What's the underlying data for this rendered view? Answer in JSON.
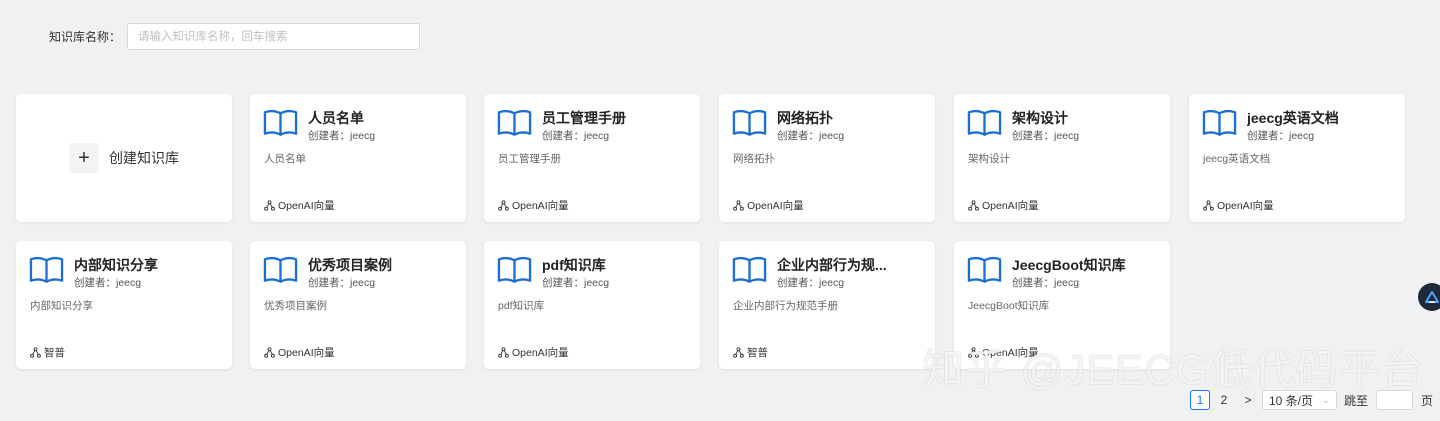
{
  "search": {
    "label": "知识库名称：",
    "placeholder": "请输入知识库名称，回车搜索",
    "value": ""
  },
  "create_card": {
    "label": "创建知识库",
    "icon": "plus-icon"
  },
  "cards": [
    {
      "title": "人员名单",
      "creator": "创建者：jeecg",
      "description": "人员名单",
      "model": "OpenAI向量",
      "icon": "book-icon"
    },
    {
      "title": "员工管理手册",
      "creator": "创建者：jeecg",
      "description": "员工管理手册",
      "model": "OpenAI向量",
      "icon": "book-icon"
    },
    {
      "title": "网络拓扑",
      "creator": "创建者：jeecg",
      "description": "网络拓扑",
      "model": "OpenAI向量",
      "icon": "book-icon"
    },
    {
      "title": "架构设计",
      "creator": "创建者：jeecg",
      "description": "架构设计",
      "model": "OpenAI向量",
      "icon": "book-icon"
    },
    {
      "title": "jeecg英语文档",
      "creator": "创建者：jeecg",
      "description": "jeecg英语文档",
      "model": "OpenAI向量",
      "icon": "book-icon"
    },
    {
      "title": "内部知识分享",
      "creator": "创建者：jeecg",
      "description": "内部知识分享",
      "model": "智普",
      "icon": "book-icon"
    },
    {
      "title": "优秀项目案例",
      "creator": "创建者：jeecg",
      "description": "优秀项目案例",
      "model": "OpenAI向量",
      "icon": "book-icon"
    },
    {
      "title": "pdf知识库",
      "creator": "创建者：jeecg",
      "description": "pdf知识库",
      "model": "OpenAI向量",
      "icon": "book-icon"
    },
    {
      "title": "企业内部行为规...",
      "creator": "创建者：jeecg",
      "description": "企业内部行为规范手册",
      "model": "智普",
      "icon": "book-icon"
    },
    {
      "title": "JeecgBoot知识库",
      "creator": "创建者：jeecg",
      "description": "JeecgBoot知识库",
      "model": "OpenAI向量",
      "icon": "book-icon"
    }
  ],
  "pagination": {
    "pages": [
      "1",
      "2"
    ],
    "current": "1",
    "next": ">",
    "page_size": "10 条/页",
    "jump_label": "跳至",
    "page_suffix": "页"
  },
  "watermark": "知乎 @JEECG低代码平台",
  "colors": {
    "accent": "#1677ff",
    "icon_blue": "#1a6fd1",
    "background": "#f0f1f3"
  }
}
